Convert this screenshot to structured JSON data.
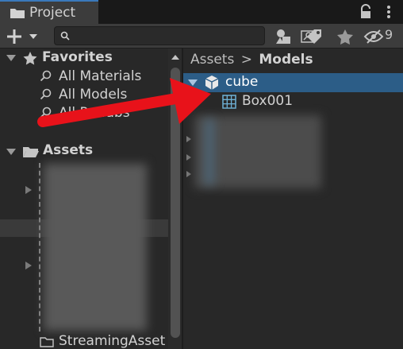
{
  "tab": {
    "label": "Project",
    "icon": "folder-icon"
  },
  "toolbar": {
    "create_icon": "plus-icon",
    "search_value": "",
    "hidden_count": "9"
  },
  "favorites": {
    "title": "Favorites",
    "items": [
      {
        "label": "All Materials"
      },
      {
        "label": "All Models"
      },
      {
        "label": "All Prefabs"
      }
    ]
  },
  "assets": {
    "title": "Assets",
    "items": [
      {
        "label": "StreamingAsset"
      }
    ]
  },
  "breadcrumb": {
    "root": "Assets",
    "separator": ">",
    "current": "Models"
  },
  "tree": {
    "items": [
      {
        "label": "cube",
        "selected": true
      },
      {
        "label": "Box001"
      }
    ]
  },
  "colors": {
    "accent": "#3a79bb",
    "selection": "#2c5d87",
    "arrow": "#e8121a"
  }
}
